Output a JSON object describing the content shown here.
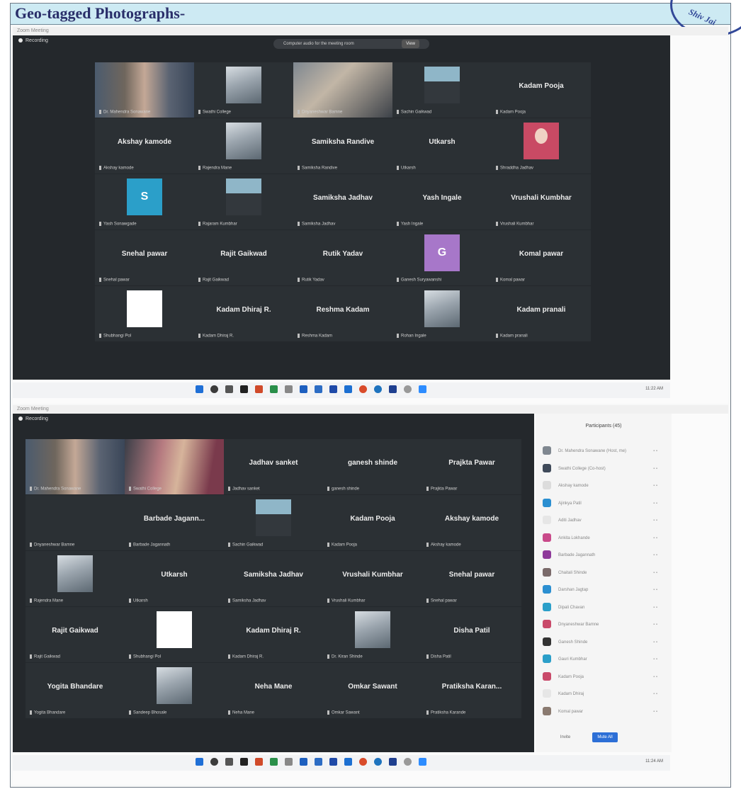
{
  "document": {
    "title": "Geo-tagged Photographs-",
    "stamp_text": "Shiv Jai"
  },
  "screenshot_top": {
    "window_title": "Zoom Meeting",
    "recording_label": "Recording",
    "view_bar_text": "Computer audio for the meeting room",
    "view_bar_button": "View",
    "tiles": [
      {
        "label": "Dr. Mahendra Sonawane",
        "kind": "video-host"
      },
      {
        "label": "Swathi College",
        "kind": "photo"
      },
      {
        "label": "Dnyaneshwar Bamne",
        "kind": "video"
      },
      {
        "label": "Sachin Gaikwad",
        "kind": "portrait"
      },
      {
        "name": "Kadam Pooja",
        "label": "Kadam Pooja"
      },
      {
        "name": "Akshay kamode",
        "label": "Akshay kamode"
      },
      {
        "label": "Rajendra Mane",
        "kind": "photo"
      },
      {
        "name": "Samiksha Randive",
        "label": "Samiksha Randive"
      },
      {
        "name": "Utkarsh",
        "label": "Utkarsh"
      },
      {
        "label": "Shraddha Jadhav",
        "kind": "pink"
      },
      {
        "label": "Yash Sonawgade",
        "kind": "initial",
        "initial": "S",
        "color": "#2b9fc9"
      },
      {
        "label": "Rajaram Kumbhar",
        "kind": "portrait"
      },
      {
        "name": "Samiksha Jadhav",
        "label": "Samiksha Jadhav"
      },
      {
        "name": "Yash Ingale",
        "label": "Yash Ingale"
      },
      {
        "name": "Vrushali Kumbhar",
        "label": "Vrushali Kumbhar"
      },
      {
        "name": "Snehal pawar",
        "label": "Snehal pawar"
      },
      {
        "name": "Rajit Gaikwad",
        "label": "Rajit Gaikwad"
      },
      {
        "name": "Rutik Yadav",
        "label": "Rutik Yadav"
      },
      {
        "label": "Ganesh Suryawanshi",
        "kind": "initial",
        "initial": "G",
        "color": "#a777c9"
      },
      {
        "name": "Komal pawar",
        "label": "Komal pawar"
      },
      {
        "label": "Shubhangi Pol",
        "kind": "blank"
      },
      {
        "name": "Kadam Dhiraj R.",
        "label": "Kadam Dhiraj R."
      },
      {
        "name": "Reshma Kadam",
        "label": "Reshma Kadam"
      },
      {
        "label": "Rohan Ingale",
        "kind": "photo"
      },
      {
        "name": "Kadam pranali",
        "label": "Kadam pranali"
      }
    ],
    "tray_time": "11:22 AM"
  },
  "screenshot_bottom": {
    "window_title": "Zoom Meeting",
    "recording_label": "Recording",
    "tiles": [
      {
        "label": "Dr. Mahendra Sonawane",
        "kind": "video-host"
      },
      {
        "label": "Swathi College",
        "kind": "video-woman"
      },
      {
        "name": "Jadhav sanket",
        "label": "Jadhav sanket"
      },
      {
        "name": "ganesh shinde",
        "label": "ganesh shinde"
      },
      {
        "name": "Prajkta Pawar",
        "label": "Prajkta Pawar"
      },
      {
        "label": "Dnyaneshwar Bamne",
        "kind": "none"
      },
      {
        "name": "Barbade Jagann...",
        "label": "Barbade Jagannath"
      },
      {
        "label": "Sachin Gaikwad",
        "kind": "portrait"
      },
      {
        "name": "Kadam Pooja",
        "label": "Kadam Pooja"
      },
      {
        "name": "Akshay kamode",
        "label": "Akshay kamode"
      },
      {
        "label": "Rajendra Mane",
        "kind": "photo"
      },
      {
        "name": "Utkarsh",
        "label": "Utkarsh"
      },
      {
        "name": "Samiksha Jadhav",
        "label": "Samiksha Jadhav"
      },
      {
        "name": "Vrushali Kumbhar",
        "label": "Vrushali Kumbhar"
      },
      {
        "name": "Snehal pawar",
        "label": "Snehal pawar"
      },
      {
        "name": "Rajit Gaikwad",
        "label": "Rajit Gaikwad"
      },
      {
        "label": "Shubhangi Pol",
        "kind": "blank"
      },
      {
        "name": "Kadam Dhiraj R.",
        "label": "Kadam Dhiraj R."
      },
      {
        "label": "Dr. Kiran Shinde",
        "kind": "photo"
      },
      {
        "name": "Disha Patil",
        "label": "Disha Patil"
      },
      {
        "name": "Yogita Bhandare",
        "label": "Yogita Bhandare"
      },
      {
        "label": "Sandeep Bhosale",
        "kind": "photo"
      },
      {
        "name": "Neha Mane",
        "label": "Neha Mane"
      },
      {
        "name": "Omkar Sawant",
        "label": "Omkar Sawant"
      },
      {
        "name": "Pratiksha Karan...",
        "label": "Pratiksha Karande"
      }
    ],
    "participants": {
      "header": "Participants (45)",
      "invite_label": "Invite",
      "mute_all_label": "Mute All",
      "rows": [
        {
          "name": "Dr. Mahendra Sonawane (Host, me)",
          "color": "#7f8790"
        },
        {
          "name": "Swathi College (Co-host)",
          "color": "#3f4a5a"
        },
        {
          "name": "Akshay kamode",
          "color": "#dcdcdc"
        },
        {
          "name": "Ajinkya Patil",
          "color": "#2b8fd1"
        },
        {
          "name": "Aditi Jadhav",
          "color": "#e6e6e6"
        },
        {
          "name": "Ankita Lokhande",
          "color": "#c94a8a"
        },
        {
          "name": "Barbade Jagannath",
          "color": "#8e3a9a"
        },
        {
          "name": "Chaitali Shinde",
          "color": "#7a6a6a"
        },
        {
          "name": "Darshan Jagtap",
          "color": "#2b8fd1"
        },
        {
          "name": "Dipali Chavan",
          "color": "#2b9fc9"
        },
        {
          "name": "Dnyaneshwar Bamne",
          "color": "#c94a6a"
        },
        {
          "name": "Ganesh Shinde",
          "color": "#333333"
        },
        {
          "name": "Gauri Kumbhar",
          "color": "#2b9fc9"
        },
        {
          "name": "Kadam Pooja",
          "color": "#c94a6a"
        },
        {
          "name": "Kadam Dhiraj",
          "color": "#e6e6e6"
        },
        {
          "name": "Komal pawar",
          "color": "#8a7a70"
        }
      ]
    },
    "tray_time": "11:24 AM"
  }
}
